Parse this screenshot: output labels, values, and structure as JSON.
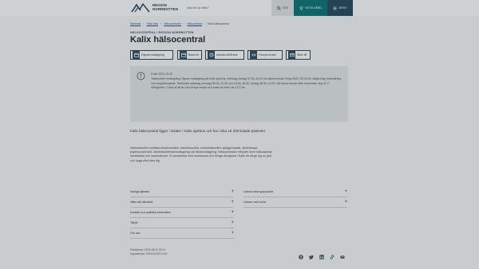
{
  "header": {
    "logo_line1": "REGION",
    "logo_line2": "NORRBOTTEN",
    "search_placeholder": "Vad vill du hitta?",
    "search_button": "SÖK",
    "help_button": "HITTA VÅRD",
    "menu_button": "MENY",
    "brand_color": "#0f6468"
  },
  "breadcrumb": [
    "Startsida",
    "Hitta vård",
    "Hälsocentraler",
    "Hälsocentral",
    "Kalix hälsocentral"
  ],
  "kicker": "HÄLSOCENTRAL I REGION NORRBOTTEN",
  "title": "Kalix hälsocentral",
  "actions": [
    {
      "label": "Öppna mottagning",
      "icon": "calendar-icon"
    },
    {
      "label": "Boka tid",
      "icon": "calendar-icon"
    },
    {
      "label": "Avboka tid/Ändra",
      "icon": "clock-icon"
    },
    {
      "label": "Förnya recept",
      "icon": "pill-icon"
    },
    {
      "label": "Skriv till",
      "icon": "envelope-icon"
    }
  ],
  "info": {
    "date": "5 mar 2024, 10:15",
    "text": "Telefontider mottagning: Öppen mottagning på Kalix sjukhus, måndag–fredag 07.30–16.00 vid akuta besvär. Ring 0923-762 00 för rådgivning, tidsbokning och receptförnyelse. Telefontid: måndag–torsdag 08.00–12.00 och 13.00–15.30, fredag 08.00–12.00. Vid akuta besvär efter kontorstid, ring 1177 Vårdguiden. Tänk på att du kan förnya recept och boka om tider via 1177.se."
  },
  "lead": "Kalix hälsocentral ligger i lokaler i Kalix sjukhus och har cirka 16 300 listade patienter.",
  "body": "Verksamheten omfattar allmänmedicin, barnhälsovård, mödrahälsovård, sjukgymnastik, arbetsterapi, psykosocialt stöd, distriktssköterskemottagning och läkarmottagning. Hälsocentralen erbjuder även hälsosamtal, livsstilsstöd och vaccinationer. Vi samarbetar med kommunen och övriga vårdgivare i Kalix för att ge dig en god och trygg vård nära dig.",
  "accordions_left": [
    "Vanliga tjänster",
    "Hitta rätt vårdnivå",
    "Kontakt och praktisk information",
    "Tillhör",
    "Om oss"
  ],
  "accordions_right": [
    "Lämna dina synpunkter",
    "Läkare med mera"
  ],
  "meta": {
    "published": "Publicerad: 2019-08-21 09:11",
    "updated": "Uppdaterad: 2024-03-05 10:15"
  },
  "share": [
    "facebook-icon",
    "twitter-icon",
    "linkedin-icon",
    "link-icon",
    "mail-icon"
  ]
}
